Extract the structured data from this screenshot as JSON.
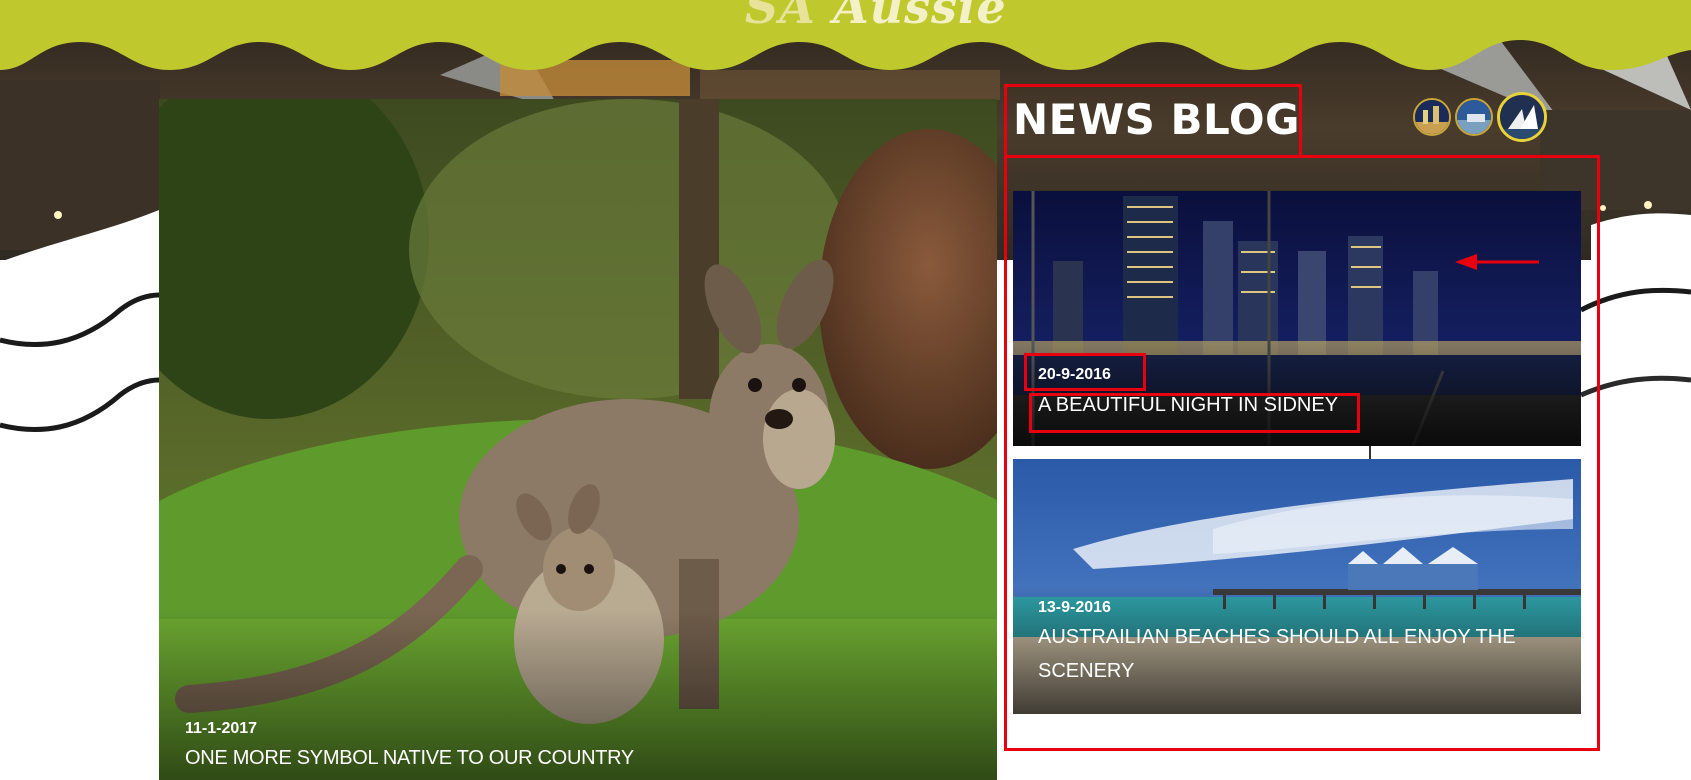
{
  "header": {
    "logo_prefix": "SA",
    "logo_text": "Aussie",
    "accent_color": "#bfc92e"
  },
  "featured": {
    "date": "11-1-2017",
    "title": "ONE MORE SYMBOL NATIVE TO OUR COUNTRY",
    "image": "kangaroo-with-joey-photo"
  },
  "news": {
    "heading": "NEWS BLOG",
    "slider_dots": [
      {
        "image": "sydney-night-thumb",
        "active": false
      },
      {
        "image": "harbour-thumb",
        "active": false
      },
      {
        "image": "opera-house-thumb",
        "active": true
      }
    ],
    "posts": [
      {
        "date": "20-9-2016",
        "title": "A BEAUTIFUL NIGHT IN SIDNEY",
        "image": "sydney-skyline-night-photo"
      },
      {
        "date": "13-9-2016",
        "title": "AUSTRAILIAN BEACHES SHOULD ALL ENJOY THE SCENERY",
        "image": "beach-jetty-photo"
      }
    ]
  },
  "annotation_color": "#e8000f"
}
